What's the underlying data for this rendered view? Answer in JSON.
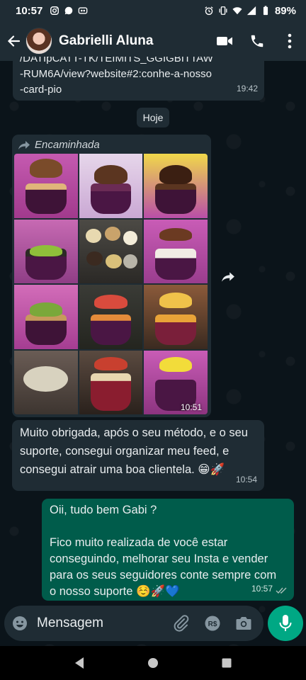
{
  "statusbar": {
    "time": "10:57",
    "battery": "89%"
  },
  "header": {
    "contact_name": "Gabrielli Aluna"
  },
  "messages": {
    "first": {
      "line1": "/DATIpCATT-TK/TEIMITS_GGIGBITTAW",
      "line2": "-RUM6A/view?website#2:conhe-a-nosso",
      "line3": "-card-pio",
      "time": "19:42"
    },
    "date_chip": "Hoje",
    "forwarded": {
      "label": "Encaminhada",
      "time": "10:51"
    },
    "thanks": {
      "text": "Muito obrigada, após o seu método, e o seu suporte, consegui organizar meu feed, e consegui atrair uma boa clientela. 😁🚀",
      "time": "10:54"
    },
    "reply": {
      "line1": "Oii,  tudo bem Gabi ?",
      "line2": "Fico muito realizada de você estar conseguindo, melhorar seu Insta e vender para os seus seguidores conte sempre com o nosso suporte ☺️🚀💙",
      "time": "10:57"
    }
  },
  "input": {
    "placeholder": "Mensagem"
  },
  "colors": {
    "background": "#0b141a",
    "bar": "#1f2c34",
    "incoming": "#1f2c34",
    "outgoing": "#005c4b",
    "accent": "#00a884"
  },
  "icons": {
    "back": "arrow-left-icon",
    "video": "video-camera-icon",
    "call": "phone-icon",
    "menu": "more-vertical-icon",
    "forward": "forward-arrow-icon",
    "emoji": "emoji-icon",
    "attach": "paperclip-icon",
    "payment": "rupee-pay-icon",
    "camera": "camera-icon",
    "mic": "microphone-icon"
  }
}
